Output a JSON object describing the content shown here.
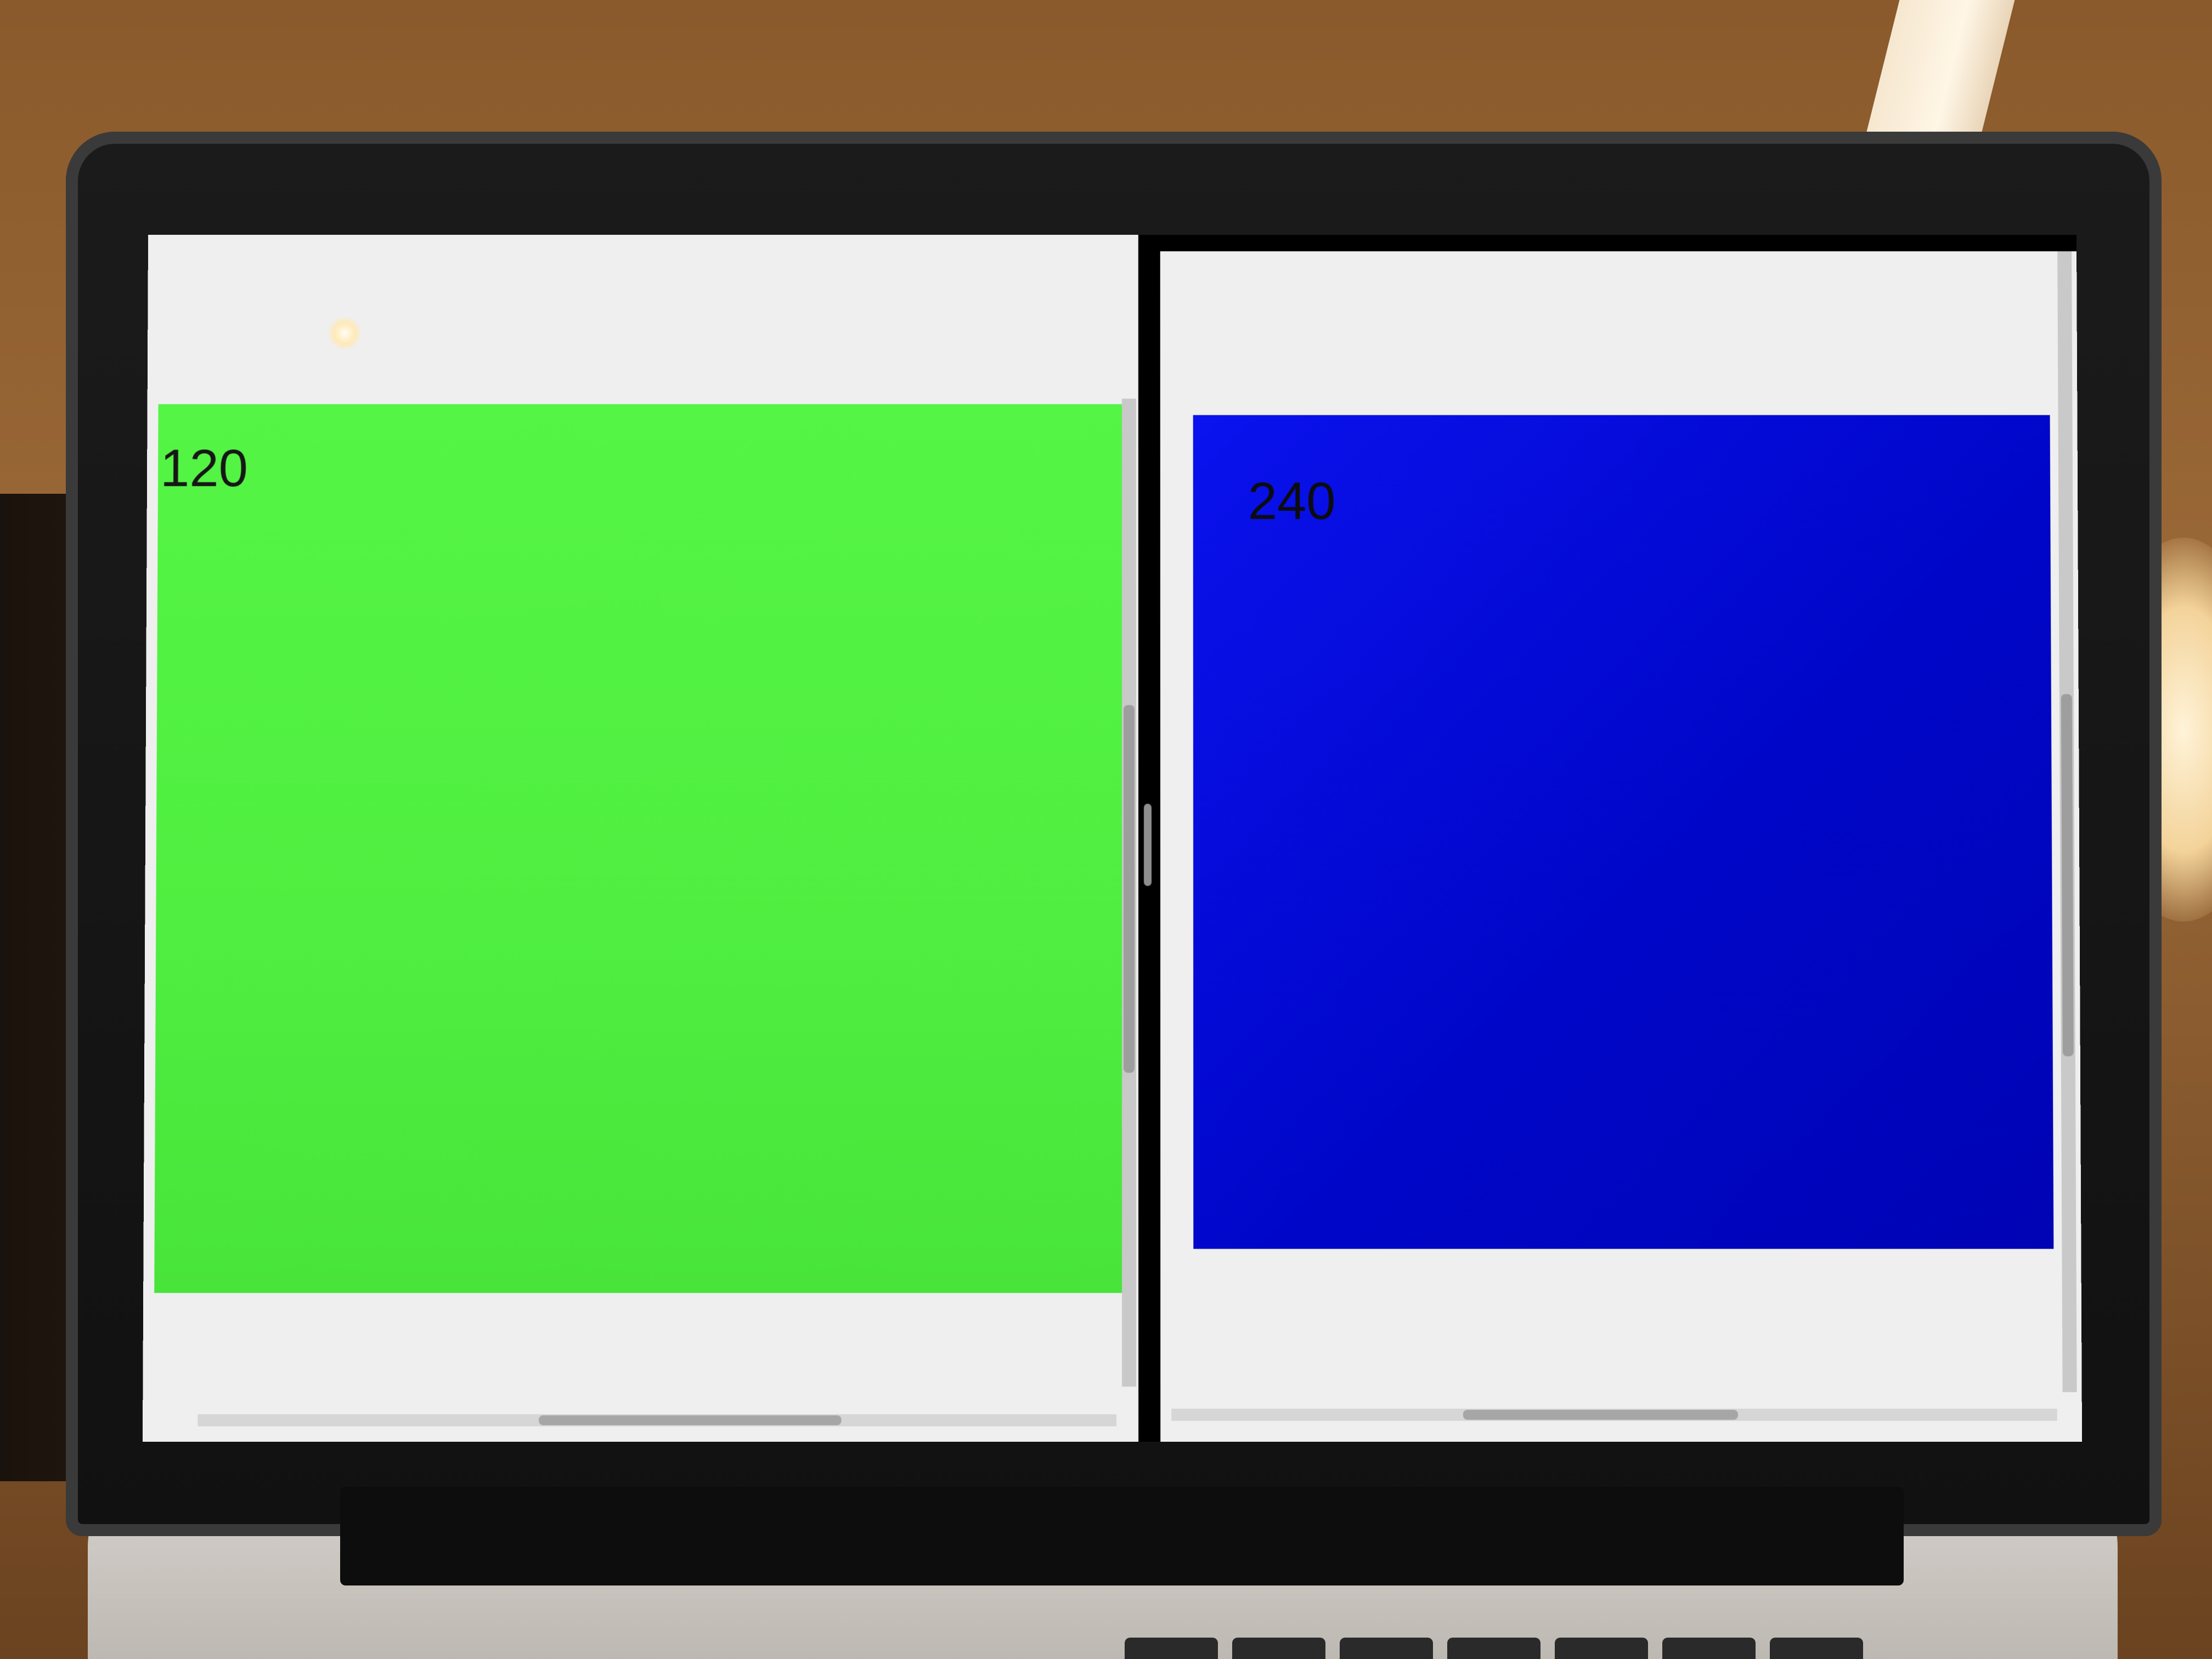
{
  "left_pane": {
    "value_label": "120",
    "panel_color": "#50F043"
  },
  "right_pane": {
    "value_label": "240",
    "panel_color": "#0008D0"
  },
  "colors": {
    "window_background": "#EFEFEF",
    "bezel": "#151515"
  }
}
